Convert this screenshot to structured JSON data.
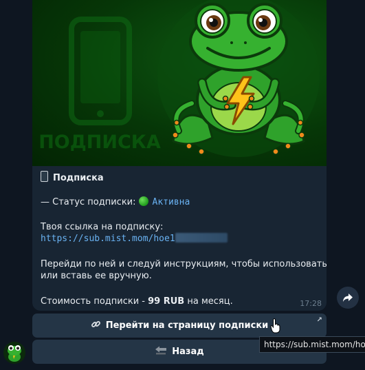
{
  "message": {
    "title_icon": "phone-icon",
    "title": "Подписка",
    "status_prefix": "— Статус подписки:",
    "status_icon": "green-circle-icon",
    "status_value": "Активна",
    "link_label": "Твоя ссылка на подписку:",
    "link_url": "https://sub.mist.mom/hoe1",
    "instruction_line1": "Перейди по ней и следуй инструкциям, чтобы использовать VPN",
    "instruction_line2": "или вставь ее вручную.",
    "price_prefix": "Стоимость подписки - ",
    "price_value": "99 RUB",
    "price_suffix": " на месяц.",
    "time": "17:28",
    "hero_watermark": "ПОДПИСКА"
  },
  "buttons": {
    "open_page": {
      "icon": "link-icon",
      "label": "Перейти на страницу подписки"
    },
    "back": {
      "icon": "back-arrow-icon",
      "label": "Назад"
    }
  },
  "tooltip": {
    "text": "https://sub.mist.mom/hoe"
  },
  "colors": {
    "background": "#0e1621",
    "bubble": "#182533",
    "button": "#243546",
    "link": "#6ab3f3",
    "status_green": "#2fb52a"
  }
}
